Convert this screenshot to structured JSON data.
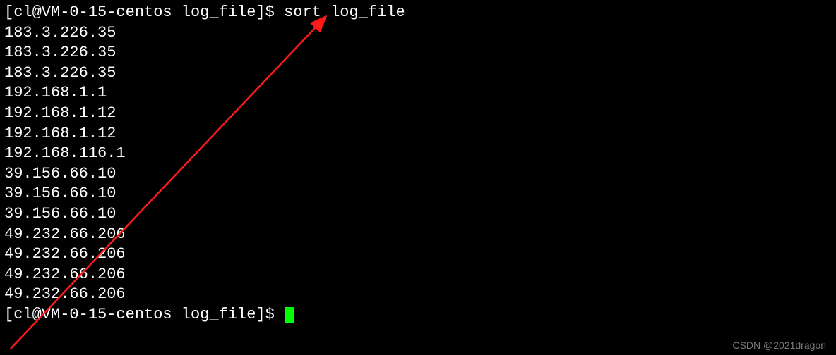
{
  "terminal": {
    "prompt1_user_host": "[cl@VM-0-15-centos log_file]$ ",
    "command": "sort log_file",
    "output": [
      "183.3.226.35",
      "183.3.226.35",
      "183.3.226.35",
      "192.168.1.1",
      "192.168.1.12",
      "192.168.1.12",
      "192.168.116.1",
      "39.156.66.10",
      "39.156.66.10",
      "39.156.66.10",
      "49.232.66.206",
      "49.232.66.206",
      "49.232.66.206",
      "49.232.66.206"
    ],
    "prompt2_user_host": "[cl@VM-0-15-centos log_file]$ "
  },
  "annotation": {
    "arrow_color": "#ff1a1a"
  },
  "watermark": "CSDN @2021dragon"
}
